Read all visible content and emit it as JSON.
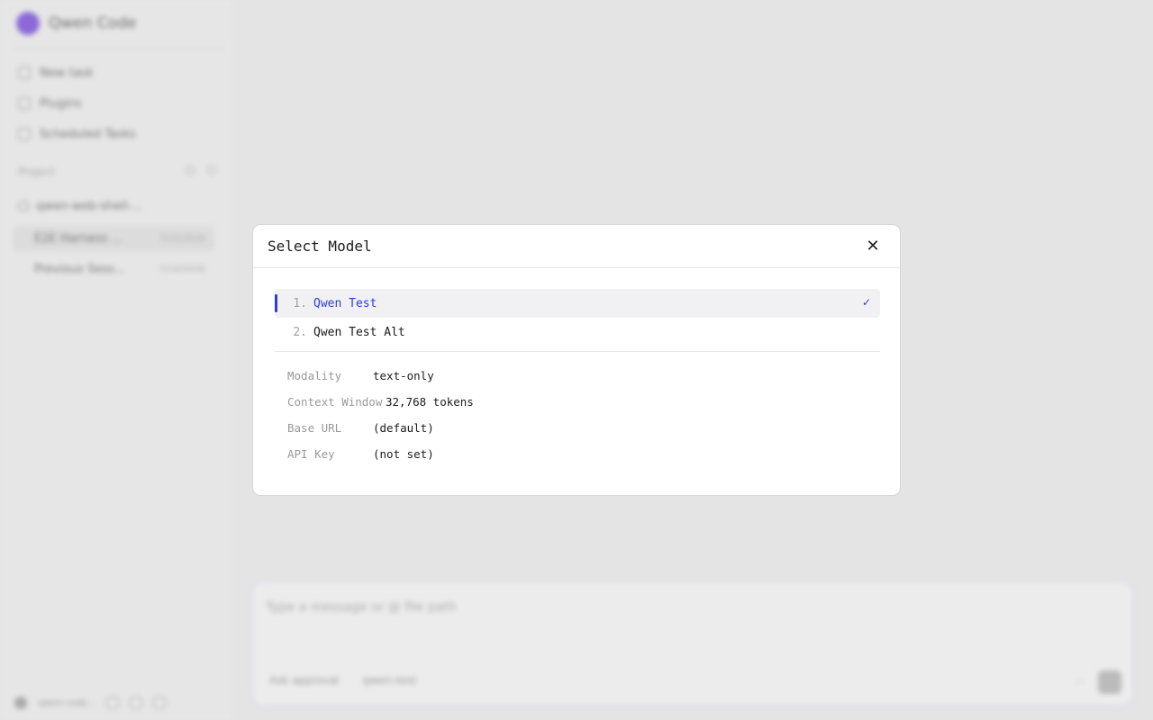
{
  "app": {
    "name": "Qwen Code"
  },
  "sidebar": {
    "nav": [
      {
        "label": "New task",
        "icon": "new-task-icon"
      },
      {
        "label": "Plugins",
        "icon": "plugin-icon"
      },
      {
        "label": "Scheduled Tasks",
        "icon": "clock-icon"
      }
    ],
    "section_label": "Project",
    "project_name": "qwen-web-shell-...",
    "sessions": [
      {
        "title": "E2E Harness ...",
        "time": "7/15/2026"
      },
      {
        "title": "Previous Sess...",
        "time": "7/14/2026"
      }
    ],
    "footer_label": "qwen-code..."
  },
  "composer": {
    "placeholder": "Type a message or @ file path",
    "approval_mode": "Ask approval",
    "model_chip": "qwen-test"
  },
  "modal": {
    "title": "Select Model",
    "close_icon": "close-icon",
    "models": [
      {
        "num": "1.",
        "label": "Qwen Test",
        "selected": true
      },
      {
        "num": "2.",
        "label": "Qwen Test Alt",
        "selected": false
      }
    ],
    "check_glyph": "✓",
    "details": [
      {
        "key": "Modality",
        "value": "text-only"
      },
      {
        "key": "Context Window",
        "value": "32,768 tokens"
      },
      {
        "key": "Base URL",
        "value": "(default)"
      },
      {
        "key": "API Key",
        "value": "(not set)"
      }
    ]
  },
  "colors": {
    "accent": "#2a3fd6",
    "selected_bg": "#f1f1f3",
    "backdrop": "#e4e4e4",
    "brand": "#8b6ad8"
  }
}
